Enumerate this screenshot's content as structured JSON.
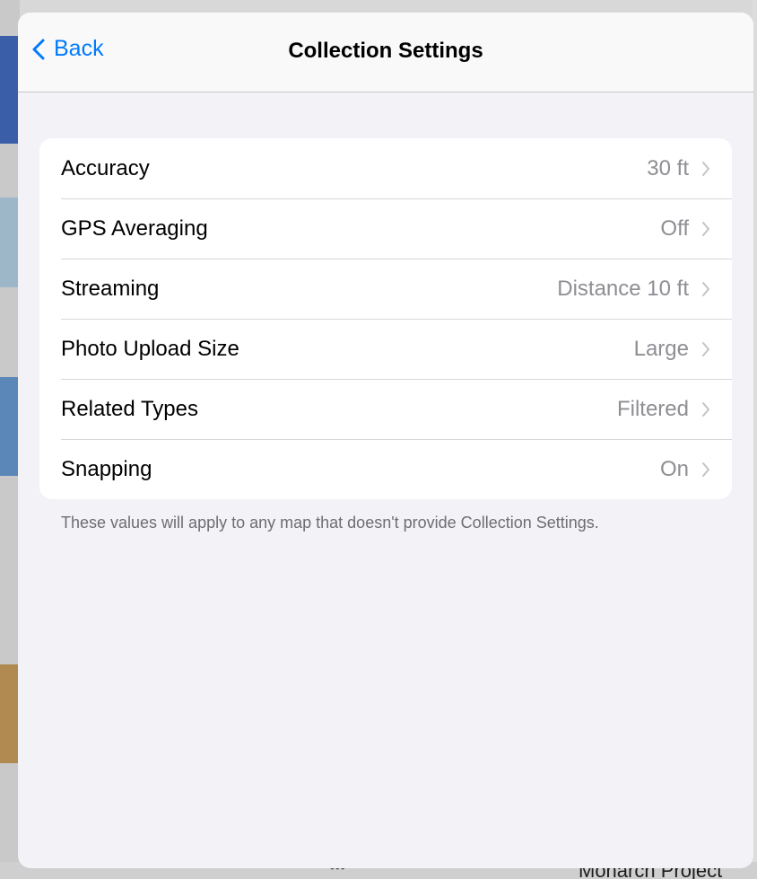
{
  "nav": {
    "back_label": "Back",
    "title": "Collection Settings"
  },
  "settings": [
    {
      "label": "Accuracy",
      "value": "30 ft"
    },
    {
      "label": "GPS Averaging",
      "value": "Off"
    },
    {
      "label": "Streaming",
      "value": "Distance 10 ft"
    },
    {
      "label": "Photo Upload Size",
      "value": "Large"
    },
    {
      "label": "Related Types",
      "value": "Filtered"
    },
    {
      "label": "Snapping",
      "value": "On"
    }
  ],
  "footer_note": "These values will apply to any map that doesn't provide Collection Settings.",
  "background": {
    "bottom_text": "Monarch Project",
    "dots": "•••"
  },
  "icons": {
    "back": "chevron-left-icon",
    "row": "chevron-right-icon"
  },
  "colors": {
    "accent": "#007aff",
    "secondary_text": "#8e8e93",
    "grouped_background": "#f2f2f7"
  }
}
